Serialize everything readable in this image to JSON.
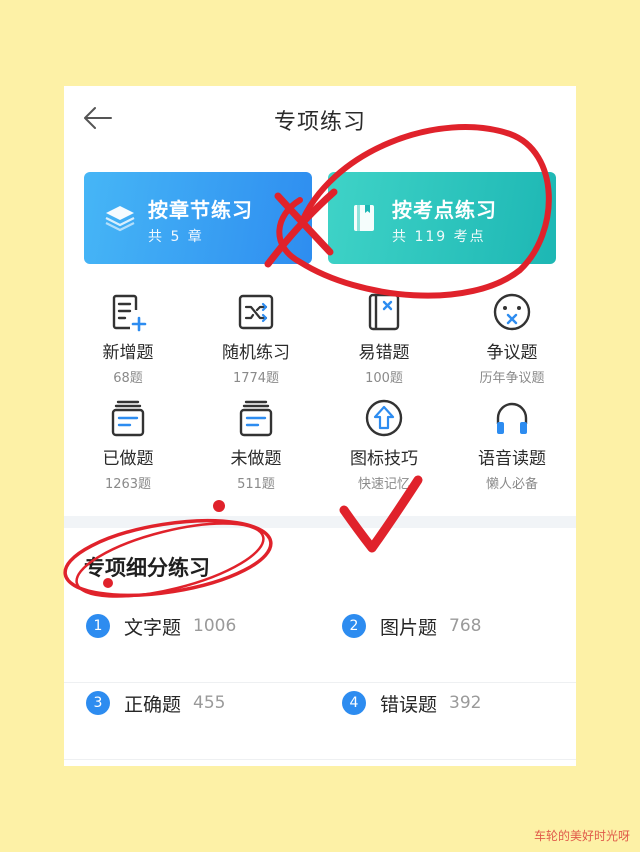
{
  "header": {
    "title": "专项练习"
  },
  "cards": [
    {
      "title": "按章节练习",
      "sub": "共 5 章"
    },
    {
      "title": "按考点练习",
      "sub": "共 119 考点"
    }
  ],
  "grid": [
    {
      "label": "新增题",
      "sub": "68题"
    },
    {
      "label": "随机练习",
      "sub": "1774题"
    },
    {
      "label": "易错题",
      "sub": "100题"
    },
    {
      "label": "争议题",
      "sub": "历年争议题"
    },
    {
      "label": "已做题",
      "sub": "1263题"
    },
    {
      "label": "未做题",
      "sub": "511题"
    },
    {
      "label": "图标技巧",
      "sub": "快速记忆"
    },
    {
      "label": "语音读题",
      "sub": "懒人必备"
    }
  ],
  "section": {
    "title": "专项细分练习"
  },
  "list": [
    {
      "num": "1",
      "name": "文字题",
      "count": "1006"
    },
    {
      "num": "2",
      "name": "图片题",
      "count": "768"
    },
    {
      "num": "3",
      "name": "正确题",
      "count": "455"
    },
    {
      "num": "4",
      "name": "错误题",
      "count": "392"
    }
  ],
  "watermark": "车轮的美好时光呀",
  "colors": {
    "accent": "#2D8CF0",
    "teal": "#1DB7B4",
    "annotation": "#E0222B",
    "background": "#FDF1A6"
  }
}
